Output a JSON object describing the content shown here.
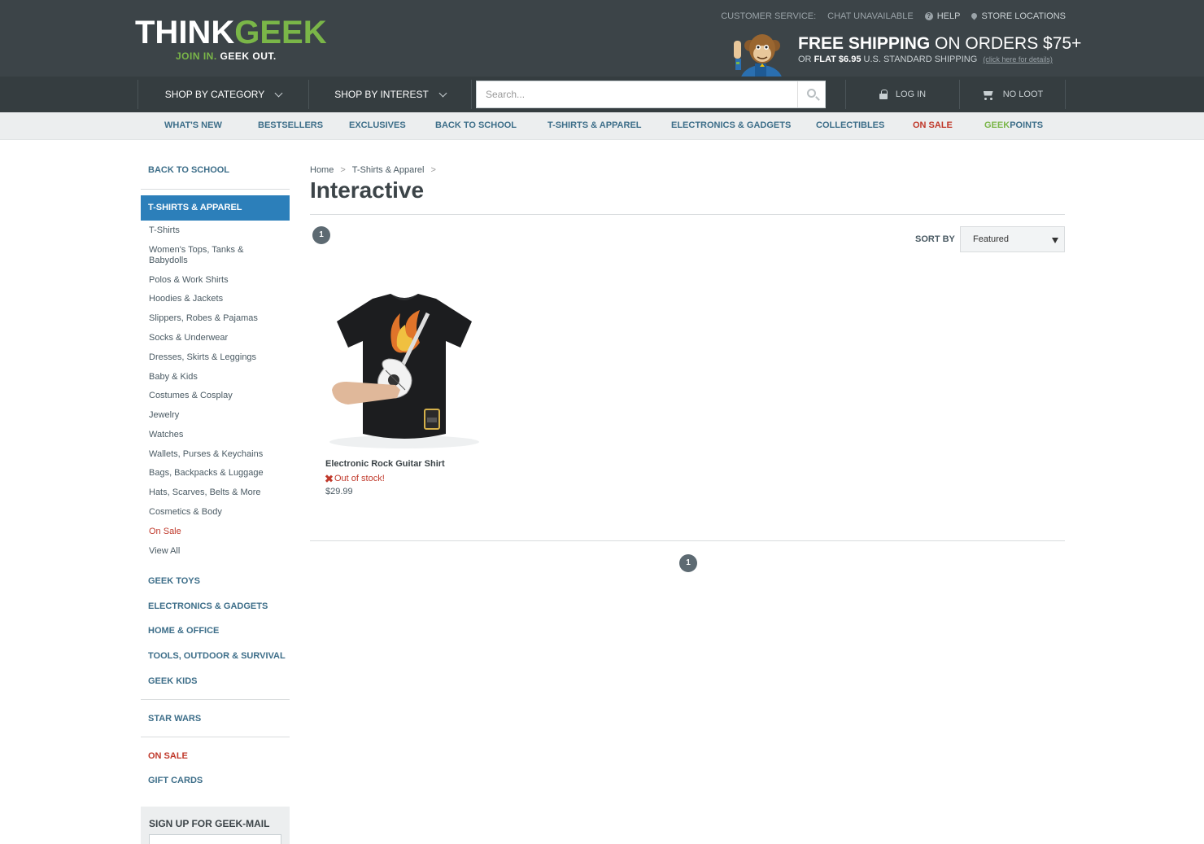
{
  "header": {
    "logo": {
      "think": "THINK",
      "geek": "GEEK",
      "tagline_a": "JOIN IN.",
      "tagline_b": "GEEK OUT."
    },
    "top_links": {
      "customer_service": "CUSTOMER SERVICE:",
      "chat": "CHAT UNAVAILABLE",
      "help": "HELP",
      "store_locations": "STORE LOCATIONS"
    },
    "shipping": {
      "free": "FREE SHIPPING",
      "on_orders": "ON ORDERS $75+",
      "or": "OR",
      "flat": "FLAT $6.95",
      "standard": "U.S. STANDARD SHIPPING",
      "details": "(click here for details)"
    }
  },
  "nav": {
    "shop_by_category": "SHOP BY CATEGORY",
    "shop_by_interest": "SHOP BY INTEREST",
    "search_placeholder": "Search...",
    "login": "LOG IN",
    "cart": "NO LOOT"
  },
  "sub_nav": {
    "items": [
      "WHAT'S NEW",
      "BESTSELLERS",
      "EXCLUSIVES",
      "BACK TO SCHOOL",
      "T-SHIRTS & APPAREL",
      "ELECTRONICS & GADGETS",
      "COLLECTIBLES",
      "ON SALE"
    ],
    "points_geek": "GEEK",
    "points_rest": "POINTS"
  },
  "sidebar": {
    "back_to_school": "BACK TO SCHOOL",
    "active": "T-SHIRTS & APPAREL",
    "subcategories": [
      "T-Shirts",
      "Women's Tops, Tanks & Babydolls",
      "Polos & Work Shirts",
      "Hoodies & Jackets",
      "Slippers, Robes & Pajamas",
      "Socks & Underwear",
      "Dresses, Skirts & Leggings",
      "Baby & Kids",
      "Costumes & Cosplay",
      "Jewelry",
      "Watches",
      "Wallets, Purses & Keychains",
      "Bags, Backpacks & Luggage",
      "Hats, Scarves, Belts & More",
      "Cosmetics & Body",
      "On Sale",
      "View All"
    ],
    "categories": [
      "GEEK TOYS",
      "ELECTRONICS & GADGETS",
      "HOME & OFFICE",
      "TOOLS, OUTDOOR & SURVIVAL",
      "GEEK KIDS"
    ],
    "star_wars": "STAR WARS",
    "on_sale": "ON SALE",
    "gift_cards": "GIFT CARDS",
    "geekmail": "SIGN UP FOR GEEK-MAIL"
  },
  "main": {
    "breadcrumb": [
      "Home",
      "T-Shirts & Apparel"
    ],
    "breadcrumb_sep": ">",
    "title": "Interactive",
    "page": "1",
    "sort_label": "SORT BY",
    "sort_value": "Featured",
    "product": {
      "name": "Electronic Rock Guitar Shirt",
      "stock": "Out of stock!",
      "price": "$29.99"
    }
  },
  "colors": {
    "header_bg": "#3c4448",
    "nav_bg": "#353d40",
    "link_blue": "#3d6e89",
    "active_blue": "#2c7fba",
    "brand_green": "#7ab648",
    "sale_red": "#c0392b"
  }
}
